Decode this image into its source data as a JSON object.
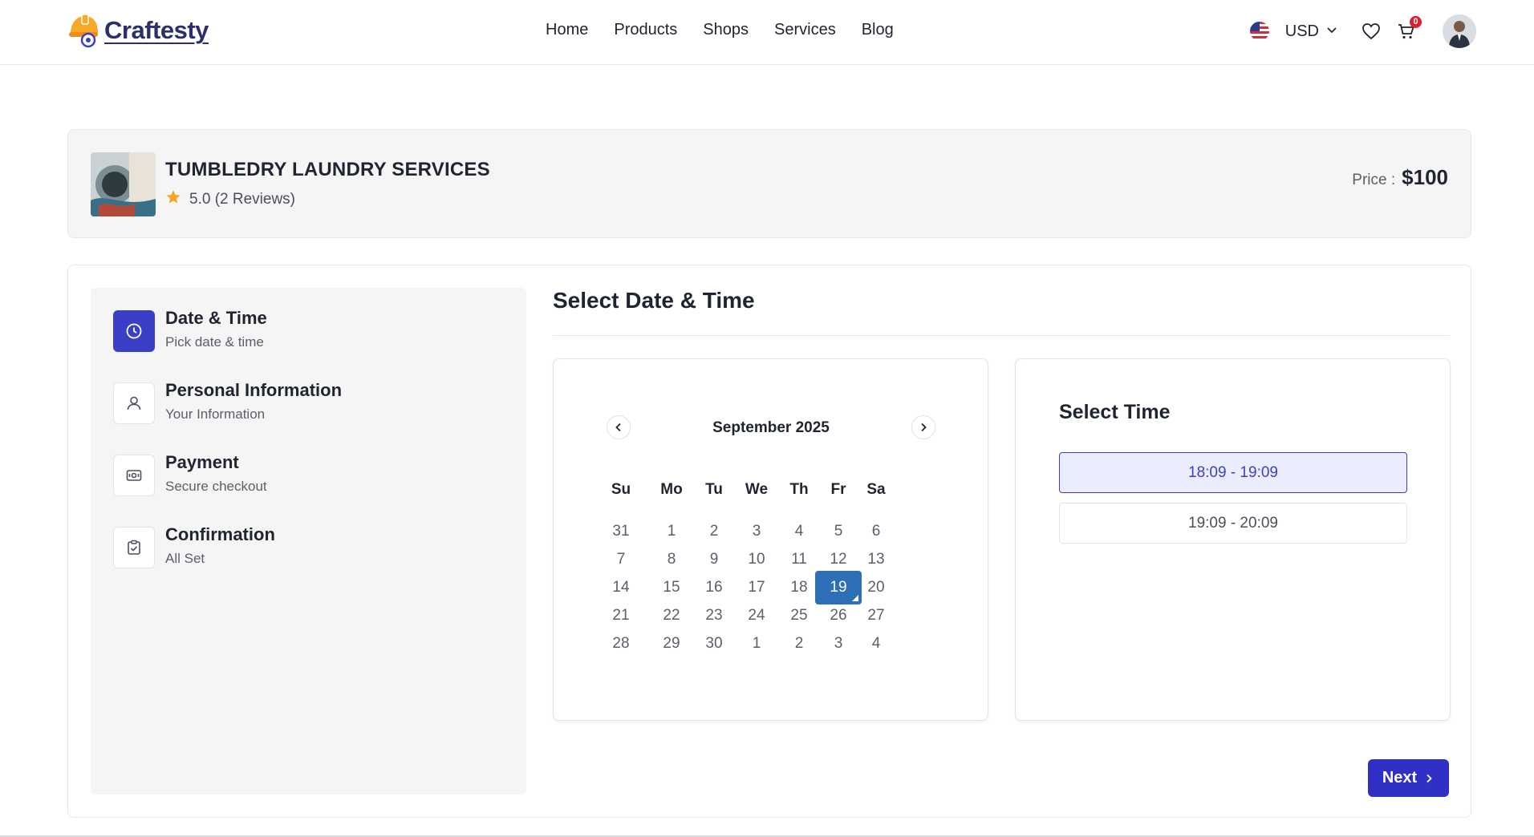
{
  "header": {
    "logo_text": "Craftesty",
    "nav": [
      "Home",
      "Products",
      "Shops",
      "Services",
      "Blog"
    ],
    "currency": "USD",
    "cart_count": "0",
    "icons": {
      "flag": "us-flag-icon",
      "currency_dropdown": "chevron-down-icon",
      "wishlist": "heart-icon",
      "cart": "cart-icon",
      "avatar": "user-avatar"
    }
  },
  "service": {
    "title": "TUMBLEDRY LAUNDRY SERVICES",
    "rating": "5.0 (2 Reviews)",
    "price_label": "Price :",
    "price_value": "$100"
  },
  "steps": [
    {
      "title": "Date & Time",
      "subtitle": "Pick date & time",
      "icon": "clock-icon",
      "active": true
    },
    {
      "title": "Personal Information",
      "subtitle": "Your Information",
      "icon": "user-icon",
      "active": false
    },
    {
      "title": "Payment",
      "subtitle": "Secure checkout",
      "icon": "payment-icon",
      "active": false
    },
    {
      "title": "Confirmation",
      "subtitle": "All Set",
      "icon": "clipboard-check-icon",
      "active": false
    }
  ],
  "section_title": "Select Date & Time",
  "calendar": {
    "month_label": "September 2025",
    "weekdays": [
      "Su",
      "Mo",
      "Tu",
      "We",
      "Th",
      "Fr",
      "Sa"
    ],
    "weeks": [
      [
        "31",
        "1",
        "2",
        "3",
        "4",
        "5",
        "6"
      ],
      [
        "7",
        "8",
        "9",
        "10",
        "11",
        "12",
        "13"
      ],
      [
        "14",
        "15",
        "16",
        "17",
        "18",
        "19",
        "20"
      ],
      [
        "21",
        "22",
        "23",
        "24",
        "25",
        "26",
        "27"
      ],
      [
        "28",
        "29",
        "30",
        "1",
        "2",
        "3",
        "4"
      ]
    ],
    "selected_day": "19"
  },
  "time": {
    "title": "Select Time",
    "slots": [
      "18:09 - 19:09",
      "19:09 - 20:09"
    ],
    "selected_slot": "18:09 - 19:09"
  },
  "next_button": "Next",
  "colors": {
    "primary": "#3b3fc8",
    "selected_day": "#2f6fb8",
    "star": "#f5a623",
    "badge": "#e11d2e"
  }
}
